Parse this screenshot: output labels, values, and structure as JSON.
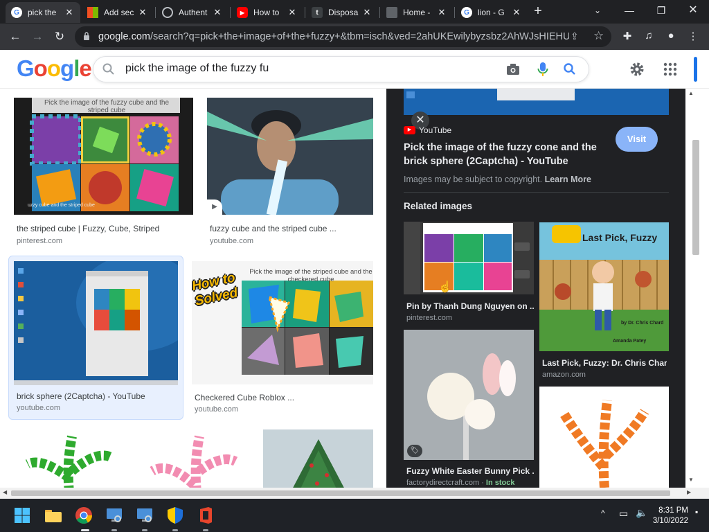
{
  "browser": {
    "tabs": [
      {
        "title": "pick the",
        "favicon": "google-icon",
        "active": true
      },
      {
        "title": "Add sec",
        "favicon": "microsoft-icon",
        "active": false
      },
      {
        "title": "Authent",
        "favicon": "globe-icon",
        "active": false
      },
      {
        "title": "How to",
        "favicon": "youtube-icon",
        "active": false
      },
      {
        "title": "Disposa",
        "favicon": "tumblr-icon",
        "active": false
      },
      {
        "title": "Home -",
        "favicon": "page-icon",
        "active": false
      },
      {
        "title": "lion - G",
        "favicon": "google-icon",
        "active": false
      }
    ],
    "url_domain": "google.com",
    "url_rest": "/search?q=pick+the+image+of+the+fuzzy+&tbm=isch&ved=2ahUKEwilybyzsbz2AhWJsHIEHU..."
  },
  "google": {
    "logo": "Google",
    "search_query": "pick the image of the fuzzy fu"
  },
  "results": [
    {
      "title": "the striped cube | Fuzzy, Cube, Striped",
      "source": "pinterest.com",
      "overlay": "Pick the image of the fuzzy cube and the striped cube",
      "caption": "uzzy cube and the striped cube"
    },
    {
      "title": "fuzzy cube and the striped cube ...",
      "source": "youtube.com"
    },
    {
      "title": "brick sphere (2Captcha) - YouTube",
      "source": "youtube.com",
      "selected": true
    },
    {
      "title": "Checkered Cube Roblox ...",
      "source": "youtube.com",
      "overlay": "Pick the image of the striped cube and the checkered cube",
      "badge": "How to Solved"
    }
  ],
  "panel": {
    "source_name": "YouTube",
    "title": "Pick the image of the fuzzy cone and the brick sphere (2Captcha) - YouTube",
    "visit_label": "Visit",
    "copyright_text": "Images may be subject to copyright.",
    "learn_more": "Learn More",
    "related_heading": "Related images",
    "related": [
      {
        "title": "Pin by Thanh Dung Nguyen on ...",
        "source": "pinterest.com"
      },
      {
        "title": "Last Pick, Fuzzy: Dr. Chris Char...",
        "source": "amazon.com",
        "book_title": "Last Pick, Fuzzy",
        "book_author": "by Dr. Chris Chard",
        "book_illustrator": "Amanda Patey"
      },
      {
        "title": "Fuzzy White Easter Bunny Pick ...",
        "source": "factorydirectcraft.com",
        "stock": "In stock"
      }
    ]
  },
  "taskbar": {
    "time": "8:31 PM",
    "date": "3/10/2022"
  },
  "colors": {
    "google_blue": "#4285f4",
    "google_red": "#ea4335",
    "google_yellow": "#fbbc05",
    "google_green": "#34a853",
    "visit_button": "#8ab4f8",
    "panel_bg": "#202124"
  }
}
